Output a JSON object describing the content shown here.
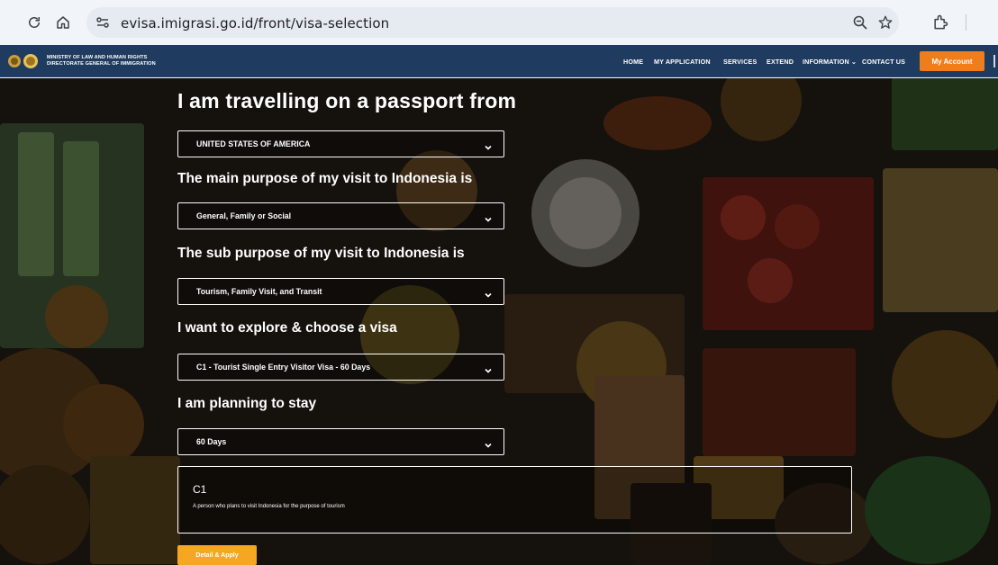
{
  "browser": {
    "url": "evisa.imigrasi.go.id/front/visa-selection",
    "icons": [
      "reload-icon",
      "home-icon",
      "site-info-icon",
      "zoom-icon",
      "star-icon",
      "extensions-icon"
    ]
  },
  "header": {
    "ministry_line1": "MINISTRY OF LAW AND HUMAN RIGHTS",
    "ministry_line2": "DIRECTORATE GENERAL OF IMMIGRATION",
    "menu": {
      "home": "HOME",
      "my_application": "MY APPLICATION",
      "services": "SERVICES",
      "extend": "EXTEND",
      "information": "INFORMATION ⌄",
      "contact": "CONTACT US"
    },
    "account_button": "My Account"
  },
  "form": {
    "title": "I am travelling on a passport from",
    "passport_country": "UNITED STATES OF AMERICA",
    "purpose_label": "The main purpose of my visit to Indonesia is",
    "purpose_value": "General, Family or Social",
    "sub_purpose_label": "The sub purpose of my visit to Indonesia is",
    "sub_purpose_value": "Tourism, Family Visit, and Transit",
    "visa_label": "I want to explore & choose a visa",
    "visa_value": "C1 - Tourist Single Entry Visitor Visa - 60 Days",
    "stay_label": "I am planning to stay",
    "stay_value": "60 Days"
  },
  "info_card": {
    "code": "C1",
    "description": "A person who plans to visit Indonesia for the purpose of tourism"
  },
  "apply_button": "Detail & Apply",
  "colors": {
    "nav_bg": "#1f3b5f",
    "account_button": "#ef7d1b",
    "apply_button": "#f5a623"
  }
}
